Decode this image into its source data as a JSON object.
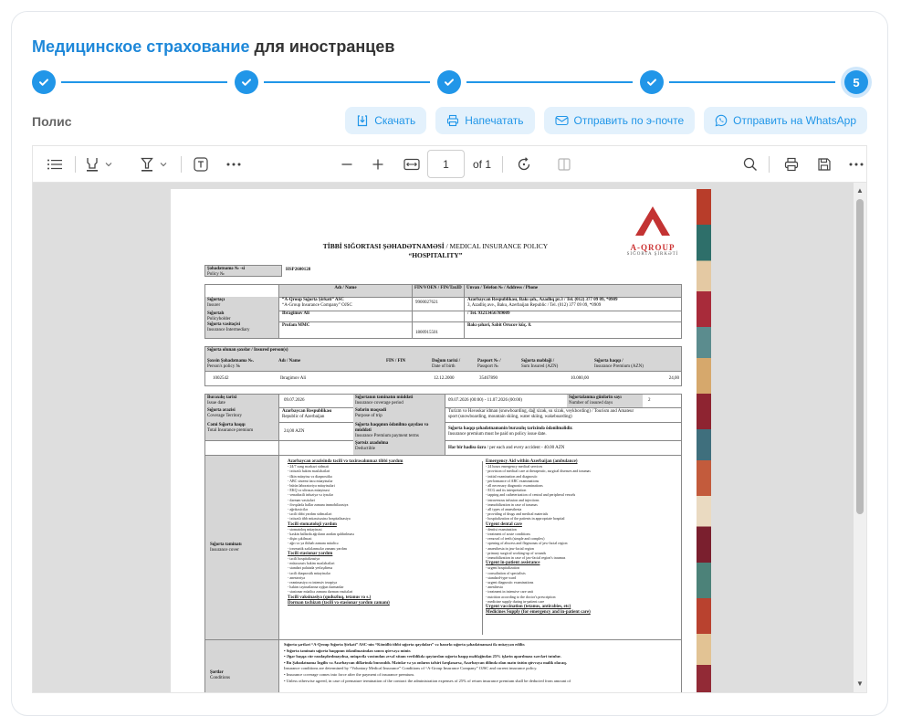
{
  "page": {
    "title_highlight": "Медицинское страхование",
    "title_rest": "для иностранцев",
    "section_label": "Полис",
    "current_step": "5"
  },
  "actions": {
    "download": "Скачать",
    "print": "Напечатать",
    "email": "Отправить по э-почте",
    "whatsapp": "Отправить на WhatsApp"
  },
  "viewer": {
    "page_number": "1",
    "page_total": "of 1"
  },
  "colors": {
    "accent": "#2196e8",
    "accent_light": "#e3f1fc",
    "logo_red": "#c33333"
  },
  "policy": {
    "logo_text": "A-QROUP",
    "logo_sub": "SIĞORTA ŞİRKƏTİ",
    "title_line1_bold": "TİBBİ SIĞORTASI ŞƏHADƏTNAMƏSİ",
    "title_line1_rest": " / MEDICAL INSURANCE POLICY",
    "title_line2": "“HOSPITALITY”",
    "cert_label": "Şəhadətnamə № -si",
    "cert_label_en": "Policy №",
    "cert_no": "HSP2600128",
    "parties_hdr": {
      "name": "Adı / Name",
      "fin": "FİN/VÖEN / FIN/TaxID",
      "address": "Ünvan / Telefon № / Address / Phone"
    },
    "parties": [
      {
        "label": "Sığortaçı",
        "label_en": "Insurer",
        "name": "“A-Qroup Sığorta Şirkəti” ASC",
        "name_en": "“A-Group Insurance Company” OJSC",
        "fin": "9900027621",
        "addr": "Azərbaycan Respublikası, Bakı şəh., Azadlıq pr.3 / Tel. (012) 377 09 09, *0909",
        "addr_en": "3, Azadliq ave., Baku, Azerbaijan Republic / Tel. (012) 377 09 09, *0909"
      },
      {
        "label": "Sığortalı",
        "label_en": "Policyholder",
        "name": "Ibragimov Ali",
        "name_en": "",
        "fin": "",
        "addr": "/ Tel. 93213456789009",
        "addr_en": ""
      },
      {
        "label": "Sığorta vasitəçisi",
        "label_en": "Insurance Intermediary",
        "name": "Profam MMC",
        "name_en": "",
        "fin": "1800915501",
        "addr": "Bakı şəhəri, Sabit Orucov küç. 8.",
        "addr_en": ""
      }
    ],
    "insured_title": "Sığorta olunan şəxslər / Insured person(s)",
    "insured_hdr": {
      "policy": "Şəxsin Şəhadətnamə №.",
      "policy_en": "Person's policy №",
      "name": "Adı / Name",
      "fin": "FİN / FIN",
      "dob": "Doğum tarixi /",
      "dob_en": "Date of birth",
      "passport": "Pasport № /",
      "passport_en": "Passport №",
      "sum": "Sığorta məbləği /",
      "sum_en": "Sum Insured (AZN)",
      "premium": "Sığorta haqqı /",
      "premium_en": "Insurance Premium (AZN)"
    },
    "insured_row": {
      "policy": "1002542",
      "name": "Ibragimov Ali",
      "fin": "",
      "dob": "12.12.2000",
      "passport": "35467890",
      "sum": "10.000,00",
      "premium": "24,00"
    },
    "terms": {
      "issue_label": "Buraxılış tarixi",
      "issue_label_en": "Issue date",
      "issue_date": "09.07.2026",
      "period_label": "Sığortanın təminatın müddəti",
      "period_label_en": "Insurance coverage period",
      "period": "09.07.2026 (00:00) - 11.07.2026 (00:00)",
      "days_label": "Sığortalanma günlərin sayı",
      "days_label_en": "Number of insured days",
      "days": "2",
      "territory_label": "Sığorta ərazisi",
      "territory_label_en": "Coverage Territory",
      "territory": "Azərbaycan Respublikası",
      "territory_en": "Republic of Azerbaijan",
      "purpose_label": "Səfərin məqsədi",
      "purpose_label_en": "Purpose of trip",
      "purpose": "Turizm və Həvəskar idman (snowboarding, dağ xizək, su xizək, veykbording) / Tourism and Amateur",
      "purpose_en": "sport (snowboarding, mountain skiing, water skiing, wakeboarding)",
      "premium_label": "Cəmi Sığorta haqqı",
      "premium_label_en": "Total Insurance premium",
      "premium": "24,00 AZN",
      "pay_label": "Sığorta haqqının ödənilmə qaydası və müddəti",
      "pay_label_en": "Insurance Premium payment terms",
      "pay": "Sığorta haqqı şəhadətnamənin buraxılış tarixində ödənilməlidir.",
      "pay_en": "Insurance premium must be paid on policy issue date.",
      "deductible_label": "Şərtsiz azadolma",
      "deductible_label_en": "Deductible",
      "deductible_bold": "Hər bir hadisə üzrə",
      "deductible": " / per each and every accident - 40.00 AZN"
    },
    "coverage_label": "Sığorta təminatı",
    "coverage_label_en": "Insurance cover",
    "cov_left": [
      {
        "h": "Azərbaycan ərazisində təcili və təxirəsalınmaz tibbi yardım",
        "items": [
          "- 24/7 zəng mərkəzi xidməti",
          "- ixtisaslı həkim məsləhətləri",
          "- ilkin müayinə və diaqnostika",
          "- ABC sistemi üzrə müayinələr",
          "- bütün laboratoriya müayinələri",
          "- EKQ və ultrasəs müayinəsi",
          "- venadaxili infuziya və iynələr",
          "- dərman vasitələri",
          "- fövqəladə hallar zamanı immobilizasiya",
          "- ağrıkəsicilər",
          "- təcili tibbi yardım xidmətləri",
          "- ixtisaslı tibb müəssisəsinə hospitalizasiya"
        ]
      },
      {
        "h": "Təcili stomatoloji yardım",
        "items": [
          "- stomatoloq müayinəsi",
          "- kəskin hallarda ağrıların aradan qaldırılması",
          "- dişin çəkilməsi",
          "- ağrı və ya iltihab zamanı müalicə",
          "- travmatik zədələnmələr zamanı yardım"
        ]
      },
      {
        "h": "Təcili stasionar yardım",
        "items": [
          "- təcili hospitalizasiya",
          "- mütəxəssis həkim məsləhətləri",
          "- standart palatada yerləşdirmə",
          "- təcili diaqnostik müayinələr",
          "- anesteziya",
          "- reanimasiya və intensiv terapiya",
          "- həkim təyinatlarına uyğun dərmanlar",
          "- stasionar müalicə zamanı dərman vasitələri"
        ]
      },
      {
        "h": "Təcili vaksinasiya (quduzluq, tetanus və s.)",
        "items": []
      },
      {
        "h": "Dərman təchizatı (təcili və stasionar yardım zamanı)",
        "items": []
      }
    ],
    "cov_right": [
      {
        "h": "Emergency Aid within Azerbaijan (ambulance)",
        "items": [
          "- 24 hours emergency medical services",
          "- provision of medical care at therapeutic, surgical diseases and traumas",
          "- initial examination and diagnostic",
          "- performance of ABC examinations",
          "- all necessary diagnostic examinations",
          "- ECG and its interpretation",
          "- tapping and catheterization of central and peripheral vessels",
          "- intravenous infusion and injections",
          "- immobilization in case of traumas",
          "- all types of anaesthesia",
          "- providing of drugs and medical materials",
          "- hospitalization of the patients in appropriate hospital"
        ]
      },
      {
        "h": "Urgent dental care",
        "items": [
          "- dentist examination",
          "- treatment of acute conditions",
          "- removal of teeth (simple and complex)",
          "- opening of abscess and flegmonas of jaw-facial region",
          "- anaesthesia in jaw-facial region",
          "- primary surgical working-up of wounds",
          "- immobilization in case of jaw-facial region's traumas"
        ]
      },
      {
        "h": "Urgent in-patient assistance",
        "items": [
          "- urgent hospitalization",
          "- consultation of specialists",
          "- standard-type ward",
          "- urgent diagnostic examinations",
          "- anesthesia",
          "- treatment in intensive care unit",
          "- nutrition according to the doctor's prescription",
          "- medicine supply during in-patient care"
        ]
      },
      {
        "h": "Urgent vaccination (tetanus, antirabies, etc)",
        "items": []
      },
      {
        "h": "Medicines Supply (for emergency and in-patient care)",
        "items": []
      }
    ],
    "conditions_label": "Şərtlər",
    "conditions_label_en": "Conditions",
    "conditions": [
      "Sığorta şərtləri “A-Qroup Sığorta Şirkəti” ASC-nin “Könüllü tibbi sığorta qaydaları” və hazırkı sığorta şəhadətnaməsi ilə müəyyən edilir.",
      "•   Sığorta təminatı sığorta haqqının ödənilməsindən sonra qüvvəyə minir.",
      "•   Əgər başqa cür razılaşdırılmayıbsa, müqavilə vaxtından əvvəl xitam verildikdə qaytarılan sığorta haqqı məbləğindən 25% işlərin aparılması xərcləri tutulur.",
      "•   Bu Şəhadətnamə İngilis və Azərbaycan dillərində buraxılıb. Mətnlər və ya onların təfsiri fərqlənərsə, Azərbaycan dilində olan mətn üstün qüvvəyə malik olacaq.",
      "Insurance conditions are determined by “Voluntary Medical Insurance” Conditions of “A-Group Insurance Company” OJSC and current insurance policy.",
      "•   Insurance coverage comes into force after the payment of insurance premium.",
      "•   Unless otherwise agreed, in case of premature termination of the contract the administration expenses of 25% of return insurance premium shall be deducted from amount of"
    ]
  }
}
